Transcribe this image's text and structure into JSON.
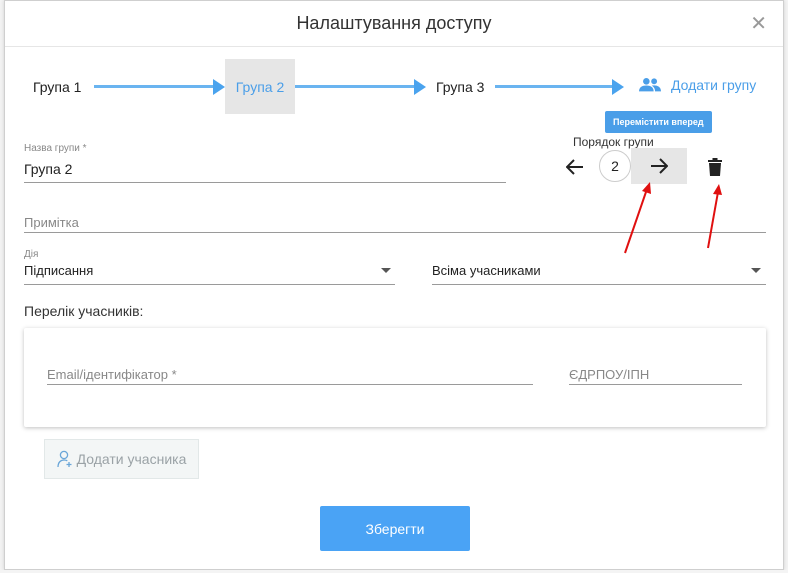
{
  "dialog": {
    "title": "Налаштування доступу",
    "close_icon": "close-icon"
  },
  "steps": [
    {
      "label": "Група 1",
      "active": false
    },
    {
      "label": "Група 2",
      "active": true
    },
    {
      "label": "Група 3",
      "active": false
    }
  ],
  "add_group": {
    "label": "Додати групу",
    "icon": "group-icon"
  },
  "order": {
    "tooltip": "Перемістити вперед",
    "label": "Порядок групи",
    "value": "2",
    "prev_icon": "arrow-left-icon",
    "next_icon": "arrow-right-icon",
    "delete_icon": "trash-icon"
  },
  "form": {
    "group_name_label": "Назва групи *",
    "group_name_value": "Група 2",
    "note_placeholder": "Примітка",
    "action_label": "Дія",
    "action_value": "Підписання",
    "mode_value": "Всіма учасниками"
  },
  "members": {
    "title": "Перелік учасників:",
    "email_placeholder": "Email/ідентифікатор *",
    "edrpou_placeholder": "ЄДРПОУ/ІПН",
    "add_member_label": "Додати учасника",
    "add_member_icon": "add-person-icon"
  },
  "save_label": "Зберегти",
  "colors": {
    "accent": "#4aa3f5",
    "step_arrow": "#6ab4f0",
    "annotation": "#e01010"
  }
}
